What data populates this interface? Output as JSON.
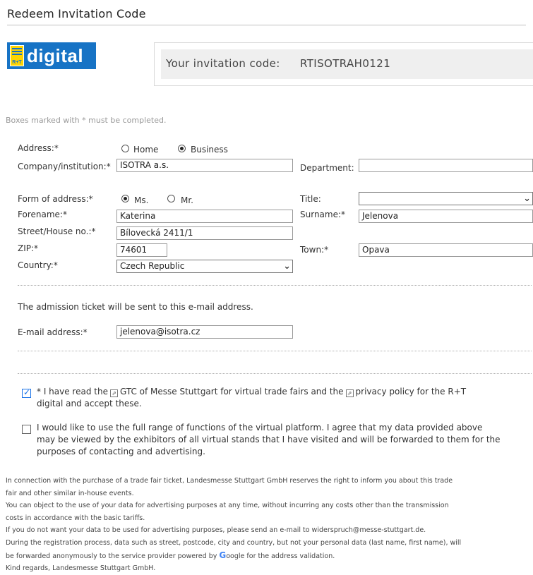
{
  "header": {
    "title": "Redeem Invitation Code"
  },
  "logo": {
    "mark_text": "R+T",
    "brand_text": "digital"
  },
  "invitation": {
    "label": "Your invitation code:",
    "code": "RTISOTRAH0121"
  },
  "required_note": "Boxes marked with * must be completed.",
  "form": {
    "address": {
      "label": "Address:*",
      "options": [
        "Home",
        "Business"
      ],
      "selected": "Business"
    },
    "company": {
      "label": "Company/institution:*",
      "value": "ISOTRA a.s."
    },
    "department": {
      "label": "Department:",
      "value": ""
    },
    "form_of_address": {
      "label": "Form of address:*",
      "options": [
        "Ms.",
        "Mr."
      ],
      "selected": "Ms."
    },
    "title": {
      "label": "Title:",
      "value": ""
    },
    "forename": {
      "label": "Forename:*",
      "value": "Katerina"
    },
    "surname": {
      "label": "Surname:*",
      "value": "Jelenova"
    },
    "street": {
      "label": "Street/House no.:*",
      "value": "Bílovecká 2411/1"
    },
    "zip": {
      "label": "ZIP:*",
      "value": "74601"
    },
    "town": {
      "label": "Town:*",
      "value": "Opava"
    },
    "country": {
      "label": "Country:*",
      "value": "Czech Republic"
    },
    "ticket_note": "The admission ticket will be sent to this e-mail address.",
    "email": {
      "label": "E-mail address:*",
      "value": "jelenova@isotra.cz"
    }
  },
  "consents": {
    "gtc": {
      "checked": true,
      "text_1": "* I have read the",
      "link_1": "GTC of Messe Stuttgart for virtual trade fairs and the",
      "link_2": "privacy policy for the R+T",
      "text_2": "digital and accept these."
    },
    "platform": {
      "checked": false,
      "line_1": "I would like to use the full range of functions of the virtual platform. I agree that my data provided above",
      "line_2": "may be viewed by the exhibitors of all virtual stands that I have visited and will be forwarded to them for the",
      "line_3": "purposes of contacting and advertising."
    }
  },
  "footer": {
    "lines": [
      "In connection with the purchase of a trade fair ticket, Landesmesse Stuttgart GmbH reserves the right to inform you about this trade",
      "fair and other similar in-house events.",
      "You can object to the use of your data for advertising purposes at any time, without incurring any costs other than the transmission",
      "costs in accordance with the basic tariffs.",
      "If you do not want your data to be used for advertising purposes, please send an e-mail to widerspruch@messe-stuttgart.de.",
      "During the registration process, data such as street, postcode, city and country, but not your personal data (last name, first name), will"
    ],
    "google_line_pre": "be forwarded anonymously to the service provider powered by",
    "google_word": "oogle",
    "google_line_post": "for the address validation.",
    "regards": "Kind regards, Landesmesse Stuttgart GmbH."
  },
  "colors": {
    "logo_blue": "#1773c5",
    "logo_yellow": "#ffd500",
    "checkbox_blue": "#1a73e8",
    "google_blue": "#4285f4"
  },
  "icons": [
    "radio-button",
    "checkbox",
    "external-link-icon",
    "chevron-down-icon",
    "google-g-icon"
  ]
}
